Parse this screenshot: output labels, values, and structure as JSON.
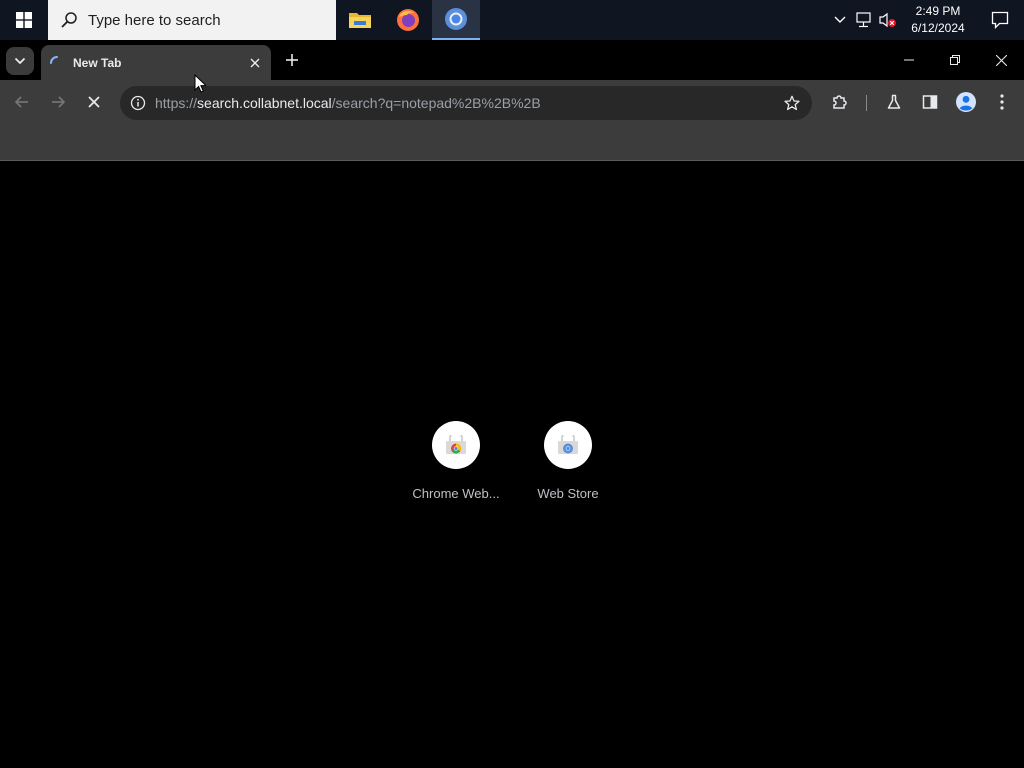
{
  "taskbar": {
    "search_placeholder": "Type here to search",
    "apps": [
      {
        "name": "file-explorer",
        "active": false
      },
      {
        "name": "firefox",
        "active": false
      },
      {
        "name": "chrome",
        "active": true
      }
    ],
    "clock": {
      "time": "2:49 PM",
      "date": "6/12/2024"
    }
  },
  "browser": {
    "tab": {
      "title": "New Tab",
      "loading": true
    },
    "omnibox": {
      "scheme": "https://",
      "host": "search.collabnet.local",
      "path": "/search?q=notepad%2B%2B%2B"
    },
    "reload_state": "stop"
  },
  "shortcuts": [
    {
      "label": "Chrome Web...",
      "icon": "chrome-web-store-icon"
    },
    {
      "label": "Web Store",
      "icon": "web-store-icon"
    }
  ],
  "colors": {
    "taskbar_bg": "#0f1521",
    "toolbar_bg": "#3c3c3c",
    "omnibox_bg": "#282828",
    "page_bg": "#000000"
  }
}
